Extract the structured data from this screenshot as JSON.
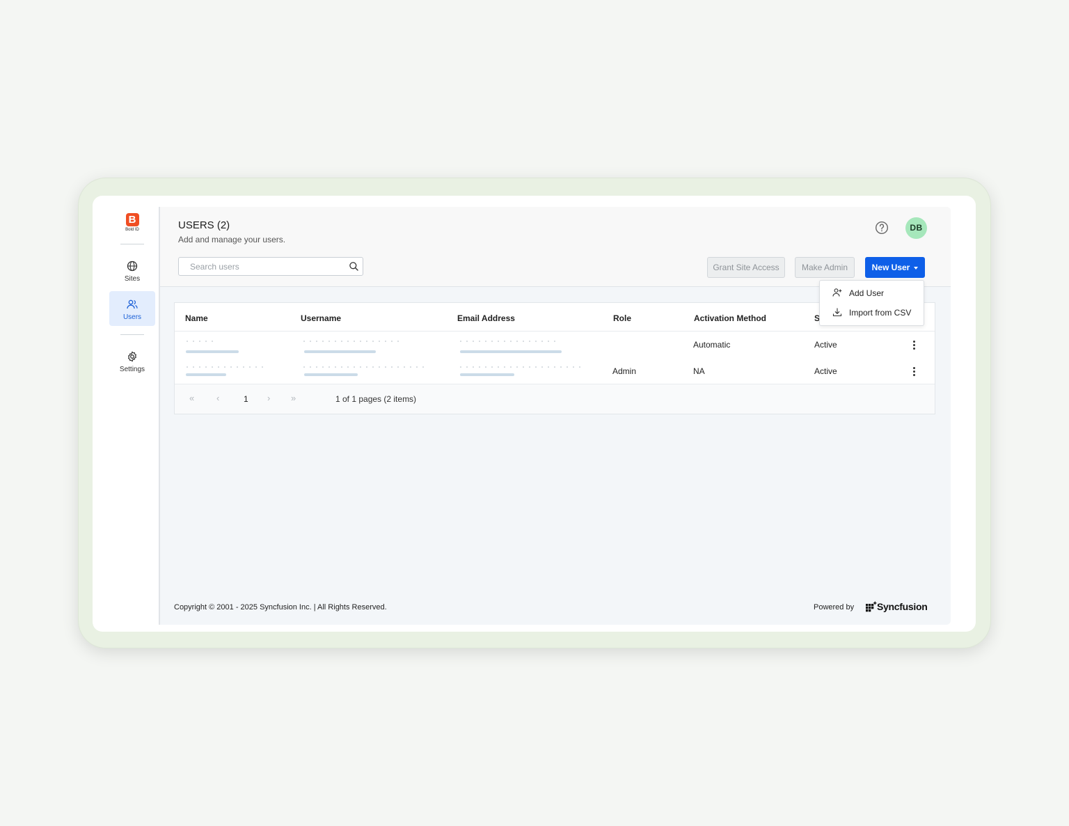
{
  "brand": {
    "logo_letter": "B",
    "logo_text": "Bold ID"
  },
  "sidebar": {
    "items": [
      {
        "label": "Sites",
        "icon": "globe-icon"
      },
      {
        "label": "Users",
        "icon": "users-icon",
        "active": true
      },
      {
        "label": "Settings",
        "icon": "gear-icon"
      }
    ]
  },
  "header": {
    "title": "USERS (2)",
    "subtitle": "Add and manage your users.",
    "avatar_initials": "DB",
    "avatar_color": "#a6e7bb"
  },
  "search": {
    "placeholder": "Search users"
  },
  "toolbar": {
    "grant_label": "Grant Site Access",
    "make_admin_label": "Make Admin",
    "new_user_label": "New User",
    "primary_color": "#0e5fe8"
  },
  "dropdown": {
    "items": [
      {
        "label": "Add User",
        "icon": "add-user-icon"
      },
      {
        "label": "Import from CSV",
        "icon": "download-icon"
      }
    ]
  },
  "table": {
    "columns": [
      "Name",
      "Username",
      "Email Address",
      "Role",
      "Activation Method",
      "S"
    ],
    "rows": [
      {
        "role": "",
        "activation": "Automatic",
        "status": "Active"
      },
      {
        "role": "Admin",
        "activation": "NA",
        "status": "Active"
      }
    ]
  },
  "pager": {
    "current_page": "1",
    "info": "1 of 1 pages (2 items)"
  },
  "footer": {
    "copyright": "Copyright © 2001 - 2025 Syncfusion Inc. | All Rights Reserved.",
    "powered_by": "Powered by",
    "powered_brand": "Syncfusion"
  }
}
